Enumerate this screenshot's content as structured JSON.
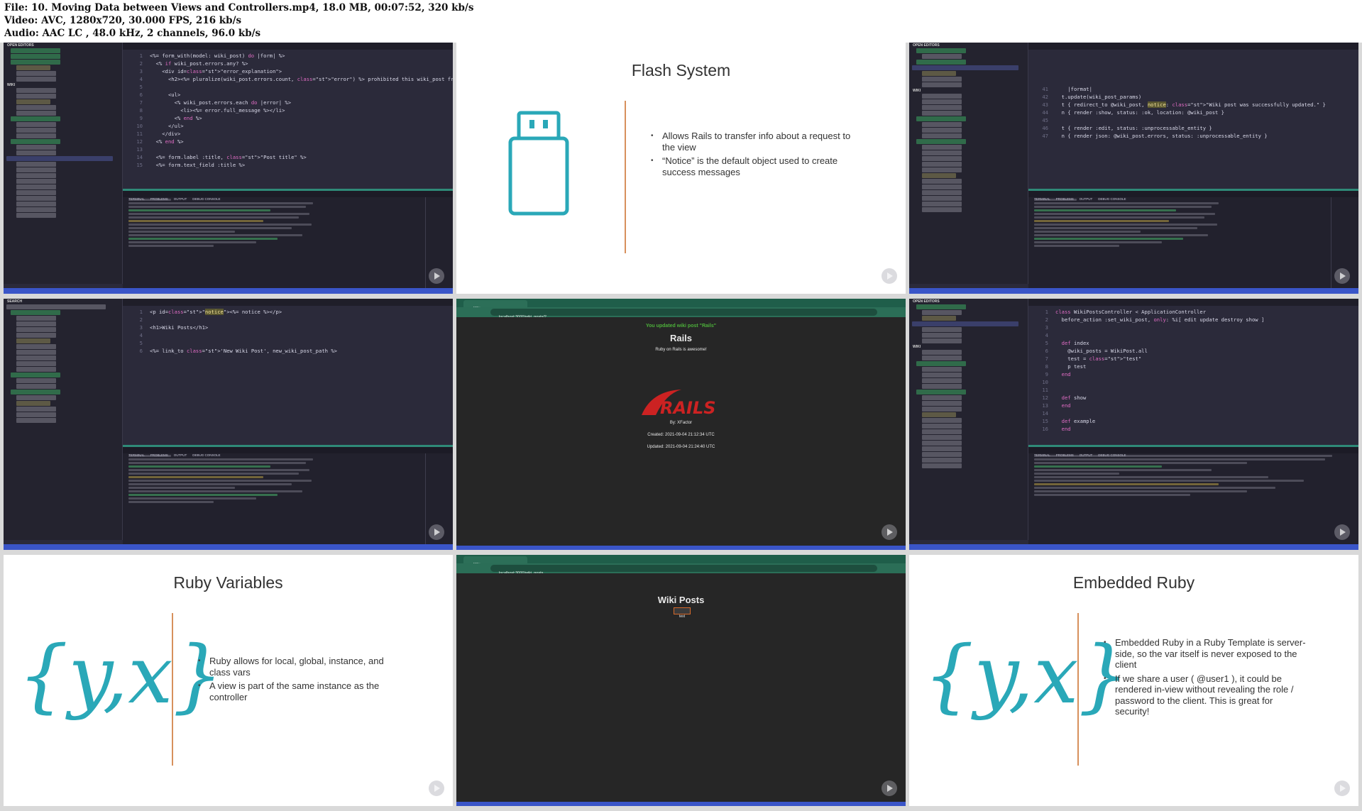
{
  "header": {
    "file_line": "File: 10. Moving Data between Views and Controllers.mp4, 18.0 MB, 00:07:52, 320 kb/s",
    "video_line": "Video: AVC, 1280x720, 30.000 FPS, 216 kb/s",
    "audio_line": "Audio: AAC LC , 48.0 kHz, 2 channels, 96.0 kb/s"
  },
  "tiles": {
    "t1": {
      "code": [
        {
          "n": "1",
          "t": "<%= form_with(model: wiki_post) do |form| %>"
        },
        {
          "n": "2",
          "t": "  <% if wiki_post.errors.any? %>"
        },
        {
          "n": "3",
          "t": "    <div id=\"error_explanation\">"
        },
        {
          "n": "4",
          "t": "      <h2><%= pluralize(wiki_post.errors.count, \"error\") %> prohibited this wiki_post fr"
        },
        {
          "n": "5",
          "t": ""
        },
        {
          "n": "6",
          "t": "      <ul>"
        },
        {
          "n": "7",
          "t": "        <% wiki_post.errors.each do |error| %>"
        },
        {
          "n": "8",
          "t": "          <li><%= error.full_message %></li>"
        },
        {
          "n": "9",
          "t": "        <% end %>"
        },
        {
          "n": "10",
          "t": "      </ul>"
        },
        {
          "n": "11",
          "t": "    </div>"
        },
        {
          "n": "12",
          "t": "  <% end %>"
        },
        {
          "n": "13",
          "t": ""
        },
        {
          "n": "14",
          "t": "  <%= form.label :title, \"Post title\" %>"
        },
        {
          "n": "15",
          "t": "  <%= form.text_field :title %>"
        }
      ]
    },
    "t2": {
      "title": "Flash System",
      "bullets": [
        "Allows Rails to transfer info about a request to the view",
        "“Notice” is the default object used to create success messages"
      ]
    },
    "t3": {
      "code": [
        {
          "n": "41",
          "t": "    |format|"
        },
        {
          "n": "42",
          "t": "  t.update(wiki_post_params)"
        },
        {
          "n": "43",
          "t": "  t { redirect_to @wiki_post, notice: \"Wiki post was successfully updated.\" }"
        },
        {
          "n": "44",
          "t": "  n { render :show, status: :ok, location: @wiki_post }"
        },
        {
          "n": "45",
          "t": ""
        },
        {
          "n": "46",
          "t": "  t { render :edit, status: :unprocessable_entity }"
        },
        {
          "n": "47",
          "t": "  n { render json: @wiki_post.errors, status: :unprocessable_entity }"
        }
      ]
    },
    "t4": {
      "code": [
        {
          "n": "1",
          "t": "<p id=\"notice\"><%= notice %></p>"
        },
        {
          "n": "2",
          "t": ""
        },
        {
          "n": "3",
          "t": "<h1>Wiki Posts</h1>"
        },
        {
          "n": "4",
          "t": ""
        },
        {
          "n": "5",
          "t": ""
        },
        {
          "n": "6",
          "t": "<%= link_to 'New Wiki Post', new_wiki_post_path %>"
        }
      ]
    },
    "t5": {
      "url": "localhost:3000/wiki_posts/2",
      "notice": "You updated wiki post \"Rails\"",
      "heading": "Rails",
      "subheading": "Ruby on Rails is awesome!",
      "author": "By: XFactor",
      "created": "Created: 2021-09-04 21:12:34 UTC",
      "updated": "Updated: 2021-09-04 21:24:40 UTC"
    },
    "t6": {
      "code": [
        {
          "n": "1",
          "t": "class WikiPostsController < ApplicationController"
        },
        {
          "n": "2",
          "t": "  before_action :set_wiki_post, only: %i[ edit update destroy show ]"
        },
        {
          "n": "3",
          "t": ""
        },
        {
          "n": "4",
          "t": ""
        },
        {
          "n": "5",
          "t": "  def index"
        },
        {
          "n": "6",
          "t": "    @wiki_posts = WikiPost.all"
        },
        {
          "n": "7",
          "t": "    test = \"test\""
        },
        {
          "n": "8",
          "t": "    p test"
        },
        {
          "n": "9",
          "t": "  end"
        },
        {
          "n": "10",
          "t": ""
        },
        {
          "n": "11",
          "t": ""
        },
        {
          "n": "12",
          "t": "  def show"
        },
        {
          "n": "13",
          "t": "  end"
        },
        {
          "n": "14",
          "t": ""
        },
        {
          "n": "15",
          "t": "  def example"
        },
        {
          "n": "16",
          "t": "  end"
        }
      ]
    },
    "t7": {
      "title": "Ruby Variables",
      "bullets": [
        "Ruby allows for local, global, instance, and class vars",
        "A view is part of the same instance as the controller"
      ]
    },
    "t8": {
      "url": "localhost:3000/wiki_posts",
      "heading": "Wiki Posts",
      "badge": "test"
    },
    "t9": {
      "title": "Embedded Ruby",
      "bullets": [
        "Embedded Ruby in a Ruby Template is server-side, so the var itself is never exposed to the client",
        "If we share a user ( @user1 ), it could be rendered in-view without revealing the role / password to the client. This is great for security!"
      ]
    }
  },
  "colors": {
    "accent_teal": "#2aa8b8",
    "divider_orange": "#d7905c",
    "notice_green": "#4caf3a",
    "rails_red": "#cc2222",
    "vscode_status": "#3a55c8"
  }
}
